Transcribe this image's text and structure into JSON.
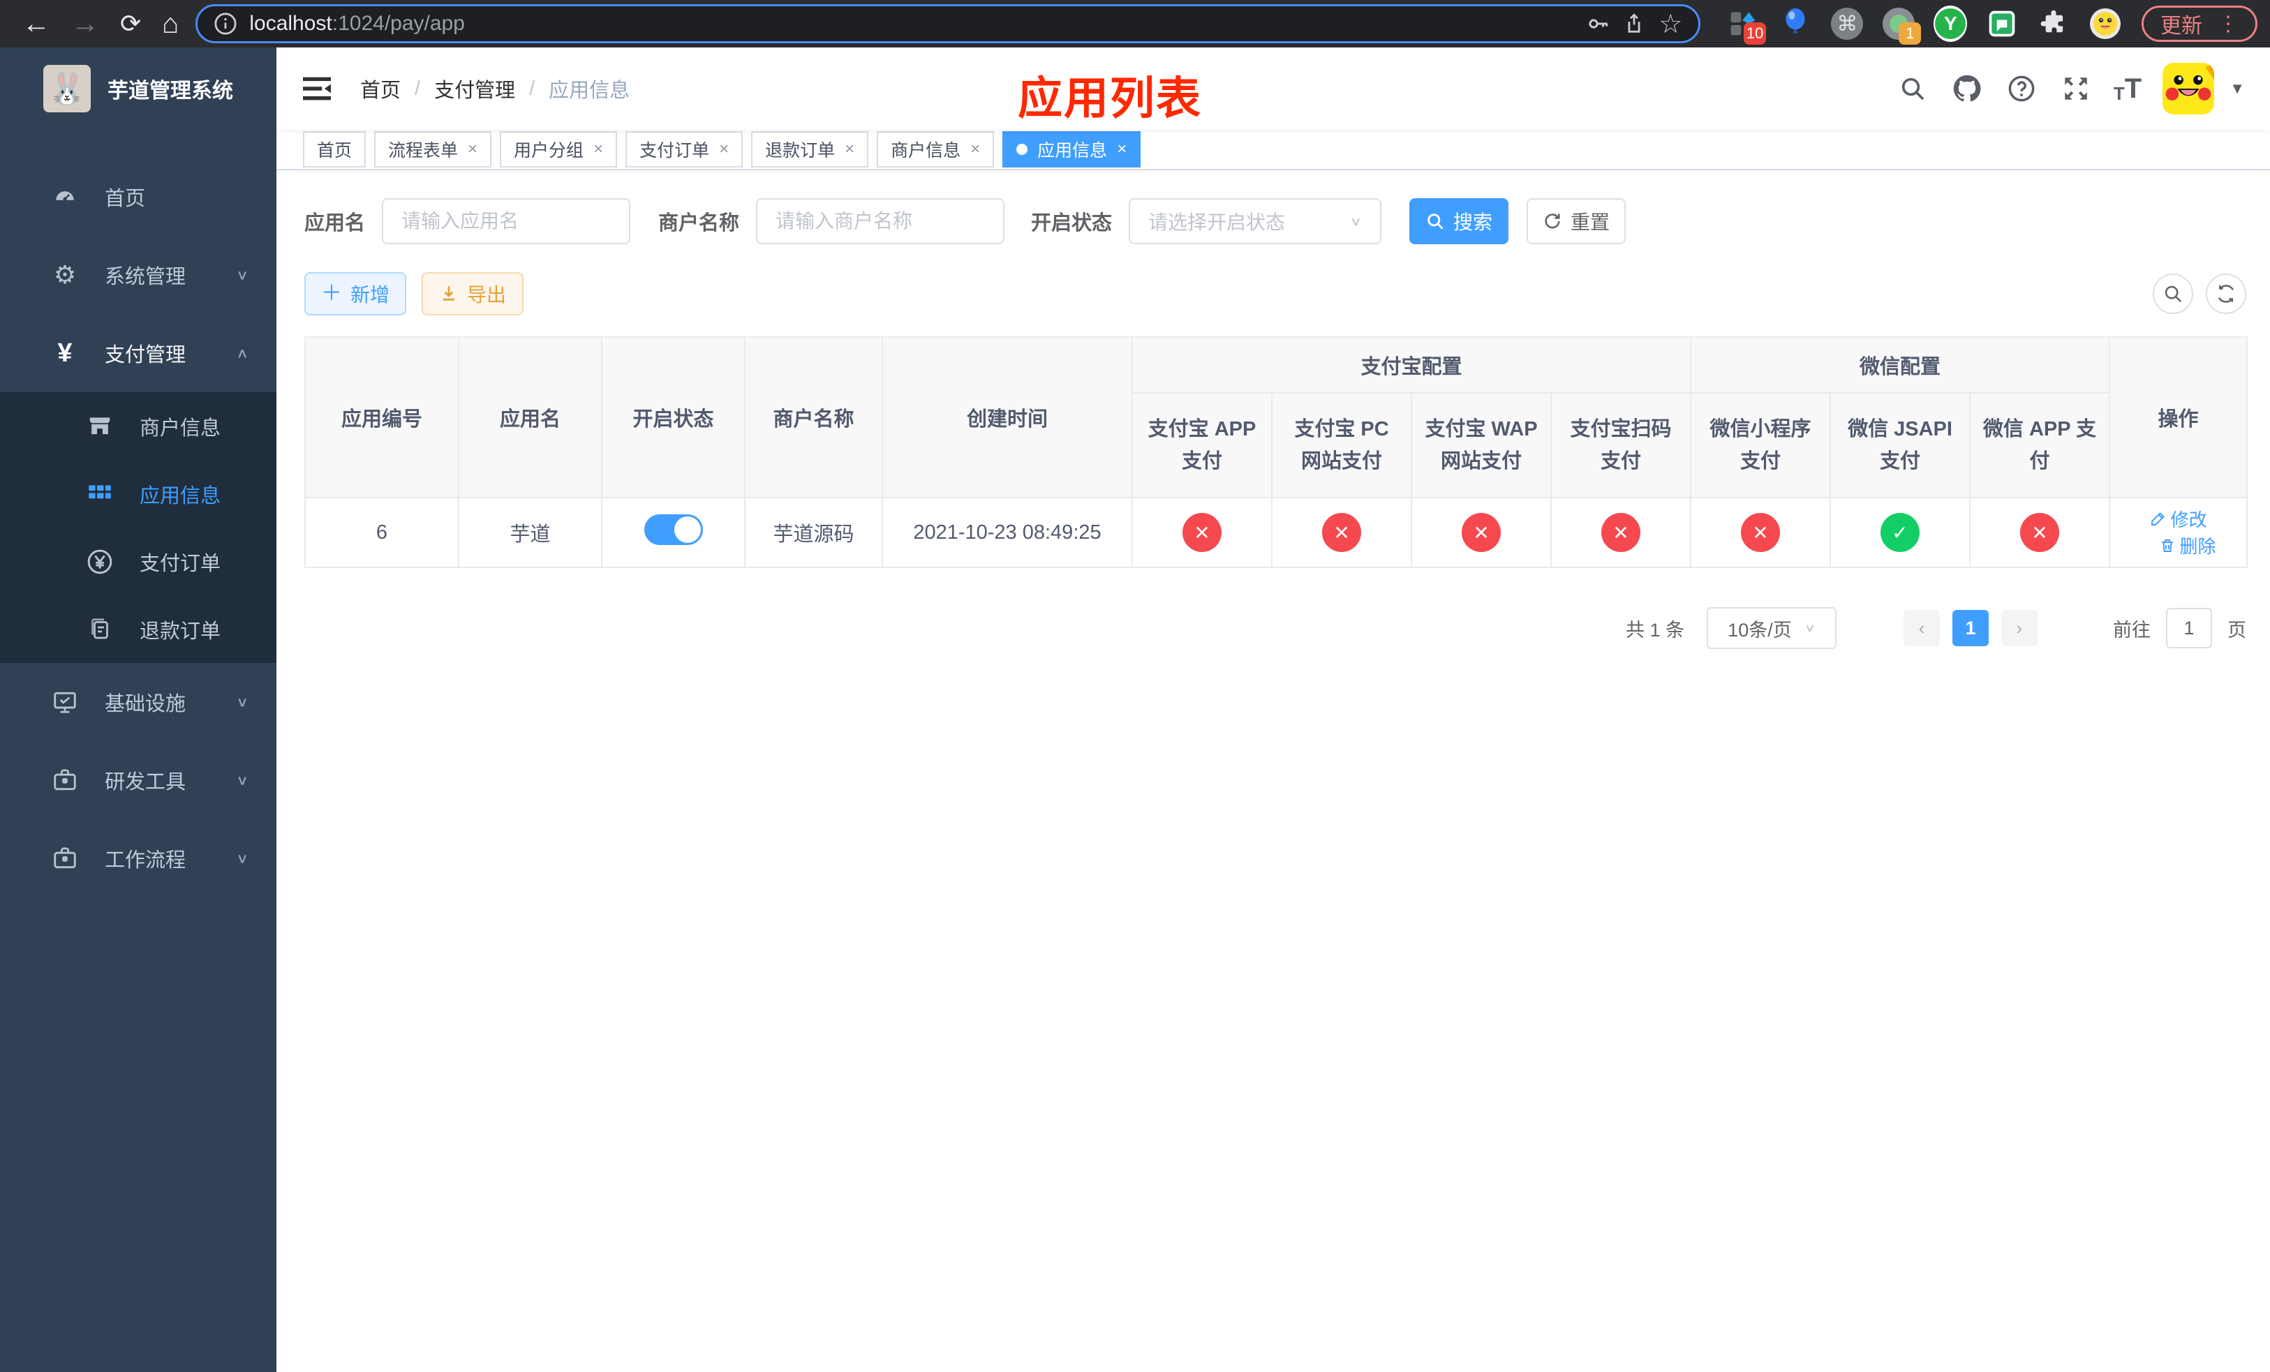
{
  "browser": {
    "url_host": "localhost",
    "url_rest": ":1024/pay/app",
    "update_label": "更新",
    "ext_badge_blocker": "10",
    "ext_badge_proxy": "1"
  },
  "sidebar": {
    "logo_title": "芋道管理系统",
    "items": [
      {
        "label": "首页"
      },
      {
        "label": "系统管理"
      },
      {
        "label": "支付管理"
      },
      {
        "label": "商户信息"
      },
      {
        "label": "应用信息"
      },
      {
        "label": "支付订单"
      },
      {
        "label": "退款订单"
      },
      {
        "label": "基础设施"
      },
      {
        "label": "研发工具"
      },
      {
        "label": "工作流程"
      }
    ]
  },
  "navbar": {
    "breadcrumb": [
      "首页",
      "支付管理",
      "应用信息"
    ],
    "page_title": "应用列表"
  },
  "tabs": [
    {
      "label": "首页"
    },
    {
      "label": "流程表单"
    },
    {
      "label": "用户分组"
    },
    {
      "label": "支付订单"
    },
    {
      "label": "退款订单"
    },
    {
      "label": "商户信息"
    },
    {
      "label": "应用信息"
    }
  ],
  "filters": {
    "app_name_label": "应用名",
    "app_name_placeholder": "请输入应用名",
    "merchant_label": "商户名称",
    "merchant_placeholder": "请输入商户名称",
    "status_label": "开启状态",
    "status_placeholder": "请选择开启状态",
    "search_label": "搜索",
    "reset_label": "重置"
  },
  "toolbar": {
    "add_label": "新增",
    "export_label": "导出"
  },
  "table": {
    "group_alipay": "支付宝配置",
    "group_wechat": "微信配置",
    "columns_left": [
      "应用编号",
      "应用名",
      "开启状态",
      "商户名称",
      "创建时间"
    ],
    "columns_alipay": [
      "支付宝 APP 支付",
      "支付宝 PC 网站支付",
      "支付宝 WAP 网站支付",
      "支付宝扫码支付"
    ],
    "columns_wechat": [
      "微信小程序支付",
      "微信 JSAPI 支付",
      "微信 APP 支付"
    ],
    "column_ops": "操作",
    "row": {
      "id": "6",
      "name": "芋道",
      "enabled": true,
      "merchant": "芋道源码",
      "created": "2021-10-23 08:49:25",
      "methods_enabled": [
        false,
        false,
        false,
        false,
        false,
        true,
        false
      ],
      "method_glyphs": [
        "✕",
        "✕",
        "✕",
        "✕",
        "✕",
        "✓",
        "✕"
      ],
      "edit_label": "修改",
      "delete_label": "删除"
    }
  },
  "pagination": {
    "total": "共 1 条",
    "page_size": "10条/页",
    "prev": "‹",
    "current_page": "1",
    "next": "›",
    "goto_label": "前往",
    "goto_value": "1",
    "page_suffix": "页"
  },
  "colors": {
    "accent": "#409eff",
    "success": "#13ce66",
    "danger": "#f5494f",
    "warning": "#e6a23c",
    "sidebar_bg": "#304156",
    "submenu_bg": "#1f2d3d",
    "annotation_red": "#ff2800"
  }
}
